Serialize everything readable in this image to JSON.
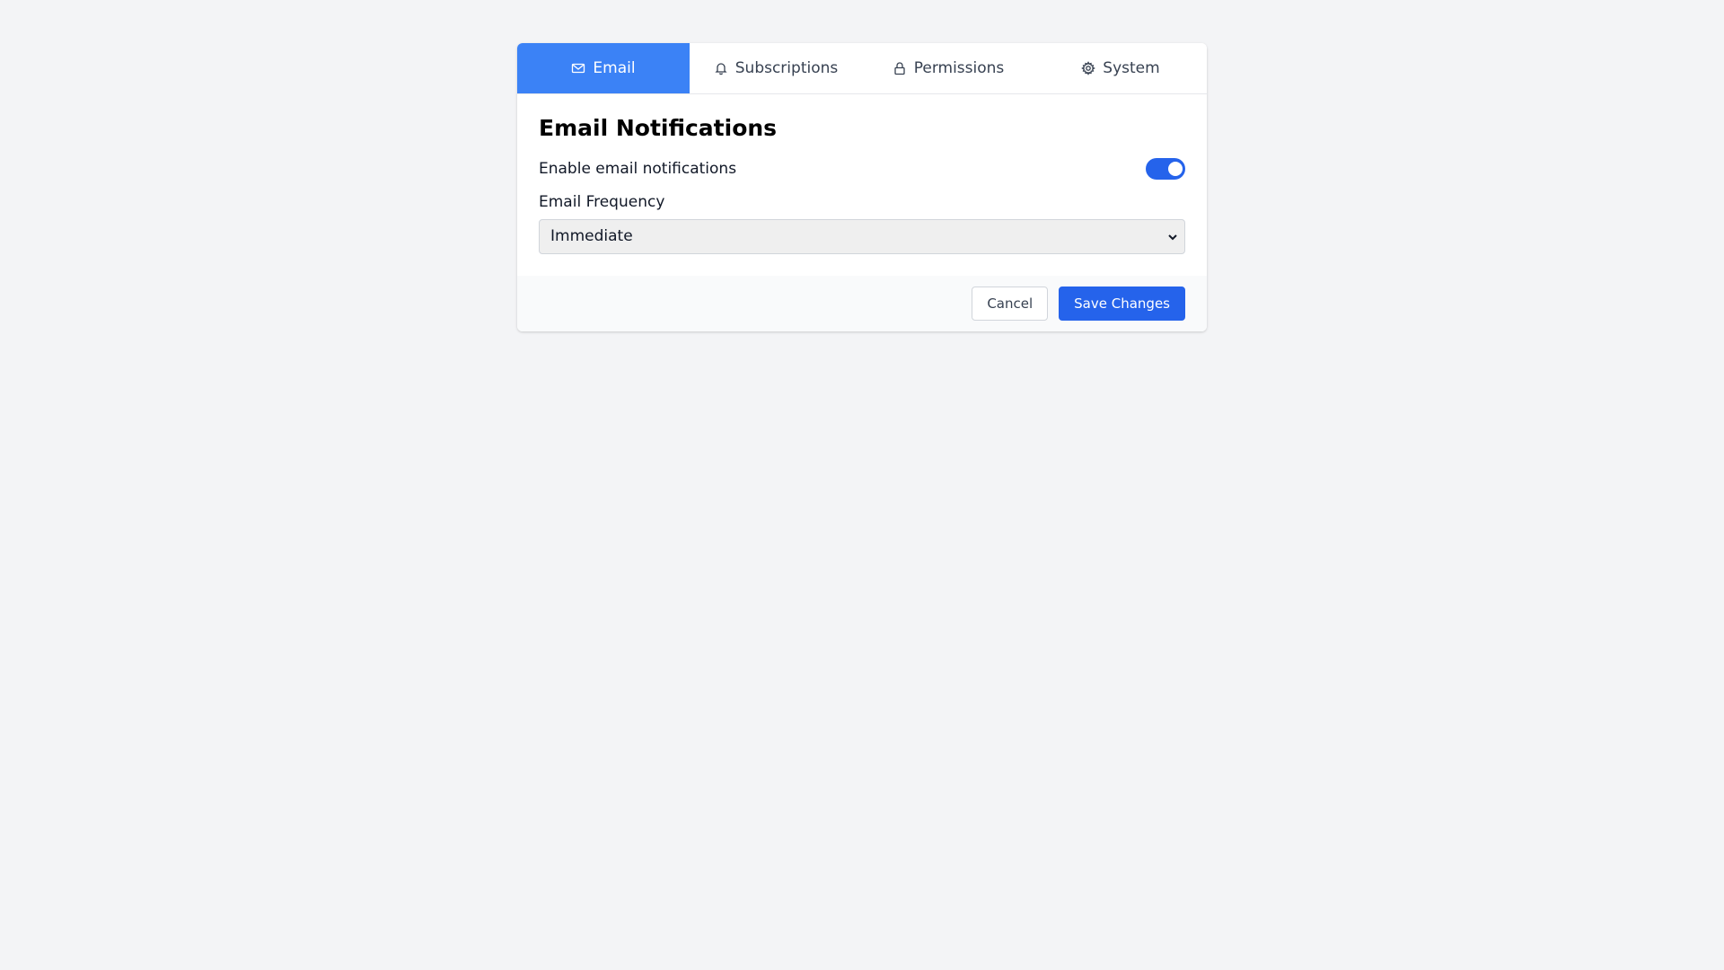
{
  "tabs": [
    {
      "label": "Email",
      "icon": "mail-icon",
      "active": true
    },
    {
      "label": "Subscriptions",
      "icon": "bell-icon",
      "active": false
    },
    {
      "label": "Permissions",
      "icon": "lock-icon",
      "active": false
    },
    {
      "label": "System",
      "icon": "gear-icon",
      "active": false
    }
  ],
  "section": {
    "title": "Email Notifications"
  },
  "toggle": {
    "label": "Enable email notifications",
    "enabled": true
  },
  "frequency": {
    "label": "Email Frequency",
    "selected": "Immediate"
  },
  "footer": {
    "cancel_label": "Cancel",
    "save_label": "Save Changes"
  },
  "colors": {
    "active_tab": "#3b82f6",
    "primary": "#2563eb",
    "background": "#f3f4f6"
  }
}
